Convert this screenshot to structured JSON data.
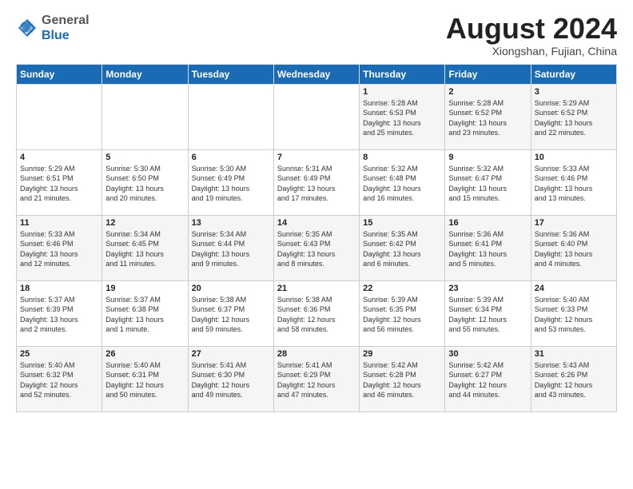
{
  "header": {
    "logo_general": "General",
    "logo_blue": "Blue",
    "month_title": "August 2024",
    "subtitle": "Xiongshan, Fujian, China"
  },
  "weekdays": [
    "Sunday",
    "Monday",
    "Tuesday",
    "Wednesday",
    "Thursday",
    "Friday",
    "Saturday"
  ],
  "weeks": [
    [
      {
        "day": "",
        "info": ""
      },
      {
        "day": "",
        "info": ""
      },
      {
        "day": "",
        "info": ""
      },
      {
        "day": "",
        "info": ""
      },
      {
        "day": "1",
        "info": "Sunrise: 5:28 AM\nSunset: 6:53 PM\nDaylight: 13 hours\nand 25 minutes."
      },
      {
        "day": "2",
        "info": "Sunrise: 5:28 AM\nSunset: 6:52 PM\nDaylight: 13 hours\nand 23 minutes."
      },
      {
        "day": "3",
        "info": "Sunrise: 5:29 AM\nSunset: 6:52 PM\nDaylight: 13 hours\nand 22 minutes."
      }
    ],
    [
      {
        "day": "4",
        "info": "Sunrise: 5:29 AM\nSunset: 6:51 PM\nDaylight: 13 hours\nand 21 minutes."
      },
      {
        "day": "5",
        "info": "Sunrise: 5:30 AM\nSunset: 6:50 PM\nDaylight: 13 hours\nand 20 minutes."
      },
      {
        "day": "6",
        "info": "Sunrise: 5:30 AM\nSunset: 6:49 PM\nDaylight: 13 hours\nand 19 minutes."
      },
      {
        "day": "7",
        "info": "Sunrise: 5:31 AM\nSunset: 6:49 PM\nDaylight: 13 hours\nand 17 minutes."
      },
      {
        "day": "8",
        "info": "Sunrise: 5:32 AM\nSunset: 6:48 PM\nDaylight: 13 hours\nand 16 minutes."
      },
      {
        "day": "9",
        "info": "Sunrise: 5:32 AM\nSunset: 6:47 PM\nDaylight: 13 hours\nand 15 minutes."
      },
      {
        "day": "10",
        "info": "Sunrise: 5:33 AM\nSunset: 6:46 PM\nDaylight: 13 hours\nand 13 minutes."
      }
    ],
    [
      {
        "day": "11",
        "info": "Sunrise: 5:33 AM\nSunset: 6:46 PM\nDaylight: 13 hours\nand 12 minutes."
      },
      {
        "day": "12",
        "info": "Sunrise: 5:34 AM\nSunset: 6:45 PM\nDaylight: 13 hours\nand 11 minutes."
      },
      {
        "day": "13",
        "info": "Sunrise: 5:34 AM\nSunset: 6:44 PM\nDaylight: 13 hours\nand 9 minutes."
      },
      {
        "day": "14",
        "info": "Sunrise: 5:35 AM\nSunset: 6:43 PM\nDaylight: 13 hours\nand 8 minutes."
      },
      {
        "day": "15",
        "info": "Sunrise: 5:35 AM\nSunset: 6:42 PM\nDaylight: 13 hours\nand 6 minutes."
      },
      {
        "day": "16",
        "info": "Sunrise: 5:36 AM\nSunset: 6:41 PM\nDaylight: 13 hours\nand 5 minutes."
      },
      {
        "day": "17",
        "info": "Sunrise: 5:36 AM\nSunset: 6:40 PM\nDaylight: 13 hours\nand 4 minutes."
      }
    ],
    [
      {
        "day": "18",
        "info": "Sunrise: 5:37 AM\nSunset: 6:39 PM\nDaylight: 13 hours\nand 2 minutes."
      },
      {
        "day": "19",
        "info": "Sunrise: 5:37 AM\nSunset: 6:38 PM\nDaylight: 13 hours\nand 1 minute."
      },
      {
        "day": "20",
        "info": "Sunrise: 5:38 AM\nSunset: 6:37 PM\nDaylight: 12 hours\nand 59 minutes."
      },
      {
        "day": "21",
        "info": "Sunrise: 5:38 AM\nSunset: 6:36 PM\nDaylight: 12 hours\nand 58 minutes."
      },
      {
        "day": "22",
        "info": "Sunrise: 5:39 AM\nSunset: 6:35 PM\nDaylight: 12 hours\nand 56 minutes."
      },
      {
        "day": "23",
        "info": "Sunrise: 5:39 AM\nSunset: 6:34 PM\nDaylight: 12 hours\nand 55 minutes."
      },
      {
        "day": "24",
        "info": "Sunrise: 5:40 AM\nSunset: 6:33 PM\nDaylight: 12 hours\nand 53 minutes."
      }
    ],
    [
      {
        "day": "25",
        "info": "Sunrise: 5:40 AM\nSunset: 6:32 PM\nDaylight: 12 hours\nand 52 minutes."
      },
      {
        "day": "26",
        "info": "Sunrise: 5:40 AM\nSunset: 6:31 PM\nDaylight: 12 hours\nand 50 minutes."
      },
      {
        "day": "27",
        "info": "Sunrise: 5:41 AM\nSunset: 6:30 PM\nDaylight: 12 hours\nand 49 minutes."
      },
      {
        "day": "28",
        "info": "Sunrise: 5:41 AM\nSunset: 6:29 PM\nDaylight: 12 hours\nand 47 minutes."
      },
      {
        "day": "29",
        "info": "Sunrise: 5:42 AM\nSunset: 6:28 PM\nDaylight: 12 hours\nand 46 minutes."
      },
      {
        "day": "30",
        "info": "Sunrise: 5:42 AM\nSunset: 6:27 PM\nDaylight: 12 hours\nand 44 minutes."
      },
      {
        "day": "31",
        "info": "Sunrise: 5:43 AM\nSunset: 6:26 PM\nDaylight: 12 hours\nand 43 minutes."
      }
    ]
  ]
}
